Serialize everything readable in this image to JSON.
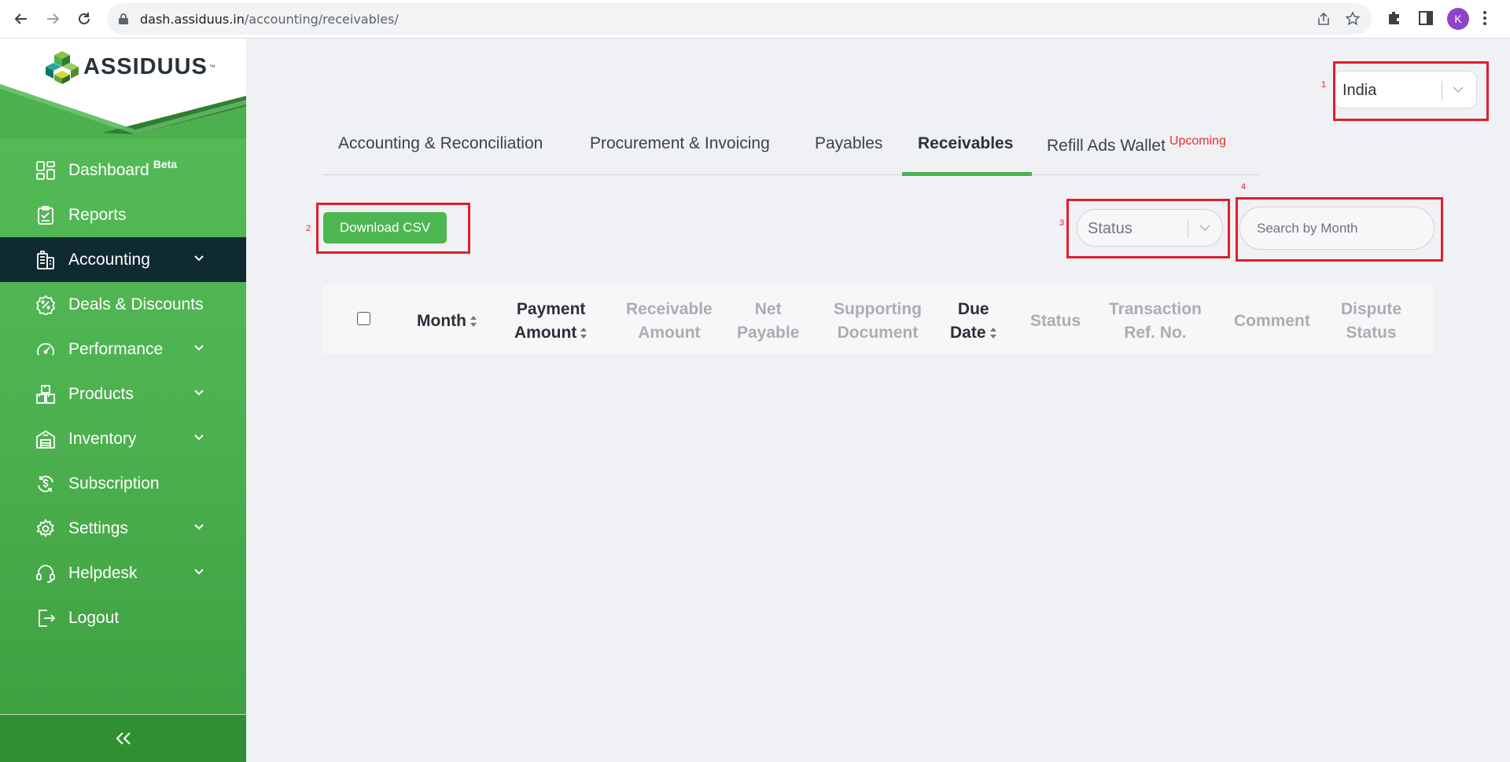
{
  "browser": {
    "url_host": "dash.assiduus.in",
    "url_path": "/accounting/receivables/",
    "avatar_letter": "K"
  },
  "brand": {
    "name": "ASSIDUUS",
    "tm": "™",
    "primary_color": "#4cb04f",
    "active_nav_color": "#102a32",
    "annotation_color": "#e11d2b",
    "upcoming_color": "#e5322d"
  },
  "sidebar": {
    "items": [
      {
        "label": "Dashboard",
        "sup": "Beta",
        "icon": "dashboard-grid-icon",
        "has_chevron": false,
        "active": false
      },
      {
        "label": "Reports",
        "icon": "clipboard-report-icon",
        "has_chevron": false,
        "active": false
      },
      {
        "label": "Accounting",
        "icon": "ledger-building-icon",
        "has_chevron": true,
        "active": true
      },
      {
        "label": "Deals & Discounts",
        "icon": "percent-badge-icon",
        "has_chevron": false,
        "active": false
      },
      {
        "label": "Performance",
        "icon": "gauge-icon",
        "has_chevron": true,
        "active": false
      },
      {
        "label": "Products",
        "icon": "boxes-icon",
        "has_chevron": true,
        "active": false
      },
      {
        "label": "Inventory",
        "icon": "warehouse-icon",
        "has_chevron": true,
        "active": false
      },
      {
        "label": "Subscription",
        "icon": "dollar-refresh-icon",
        "has_chevron": false,
        "active": false
      },
      {
        "label": "Settings",
        "icon": "gear-icon",
        "has_chevron": true,
        "active": false
      },
      {
        "label": "Helpdesk",
        "icon": "headset-icon",
        "has_chevron": true,
        "active": false
      },
      {
        "label": "Logout",
        "icon": "logout-icon",
        "has_chevron": false,
        "active": false
      }
    ],
    "collapse_icon": "double-chevron-left-icon"
  },
  "country_select": {
    "value": "India"
  },
  "annotations": {
    "n1": "1",
    "n2": "2",
    "n3": "3",
    "n4": "4"
  },
  "tabs": [
    {
      "label": "Accounting & Reconciliation",
      "active": false
    },
    {
      "label": "Procurement & Invoicing",
      "active": false
    },
    {
      "label": "Payables",
      "active": false
    },
    {
      "label": "Receivables",
      "active": true
    },
    {
      "label": "Refill Ads Wallet",
      "sup": "Upcoming",
      "active": false
    }
  ],
  "toolbar": {
    "download_csv": "Download CSV",
    "status_placeholder": "Status",
    "search_placeholder": "Search by Month"
  },
  "table": {
    "columns": [
      {
        "line1": "Month",
        "line2": "",
        "sortable": true,
        "muted": false
      },
      {
        "line1": "Payment",
        "line2": "Amount",
        "sortable": true,
        "muted": false
      },
      {
        "line1": "Receivable",
        "line2": "Amount",
        "sortable": false,
        "muted": true
      },
      {
        "line1": "Net",
        "line2": "Payable",
        "sortable": false,
        "muted": true
      },
      {
        "line1": "Supporting",
        "line2": "Document",
        "sortable": false,
        "muted": true
      },
      {
        "line1": "Due",
        "line2": "Date",
        "sortable": true,
        "muted": false
      },
      {
        "line1": "Status",
        "line2": "",
        "sortable": false,
        "muted": true
      },
      {
        "line1": "Transaction",
        "line2": "Ref. No.",
        "sortable": false,
        "muted": true
      },
      {
        "line1": "Comment",
        "line2": "",
        "sortable": false,
        "muted": true
      },
      {
        "line1": "Dispute",
        "line2": "Status",
        "sortable": false,
        "muted": true
      }
    ],
    "rows": []
  }
}
